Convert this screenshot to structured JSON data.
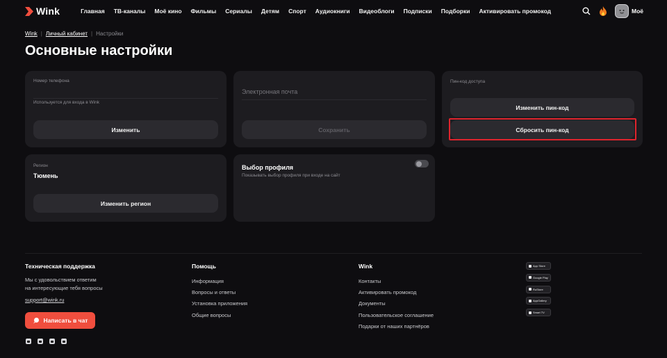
{
  "brand": {
    "name": "Wink",
    "accent": "#f04e3e",
    "highlight": "#e0242d"
  },
  "nav": [
    "Главная",
    "ТВ-каналы",
    "Моё кино",
    "Фильмы",
    "Сериалы",
    "Детям",
    "Спорт",
    "Аудиокниги",
    "Видеоблоги",
    "Подписки",
    "Подборки",
    "Активировать промокод"
  ],
  "header": {
    "profile_label": "Моё"
  },
  "breadcrumb": {
    "home": "Wink",
    "account": "Личный кабинет",
    "current": "Настройки"
  },
  "page_title": "Основные настройки",
  "phone_card": {
    "label": "Номер телефона",
    "hint": "Используется для входа в Wink",
    "button": "Изменить"
  },
  "email_card": {
    "placeholder": "Электронная почта",
    "button": "Сохранить"
  },
  "pin_card": {
    "label": "Пин-код доступа",
    "change_button": "Изменить пин-код",
    "reset_button": "Сбросить пин-код"
  },
  "region_card": {
    "label": "Регион",
    "value": "Тюмень",
    "button": "Изменить регион"
  },
  "profile_card": {
    "title": "Выбор профиля",
    "hint": "Показывать выбор профиля при входе на сайт",
    "toggle_on": false
  },
  "footer": {
    "support": {
      "title": "Техническая поддержка",
      "line1": "Мы с удовольствием ответим",
      "line2": "на интересующие тебя вопросы",
      "email": "support@wink.ru",
      "chat_button": "Написать в чат"
    },
    "help": {
      "title": "Помощь",
      "links": [
        "Информация",
        "Вопросы и ответы",
        "Установка приложения",
        "Общие вопросы"
      ]
    },
    "wink": {
      "title": "Wink",
      "links": [
        "Контакты",
        "Активировать промокод",
        "Документы",
        "Пользовательское соглашение",
        "Подарки от наших партнёров"
      ]
    },
    "stores": [
      "App Store",
      "Google Play",
      "RuStore",
      "AppGallery",
      "Smart TV"
    ]
  }
}
